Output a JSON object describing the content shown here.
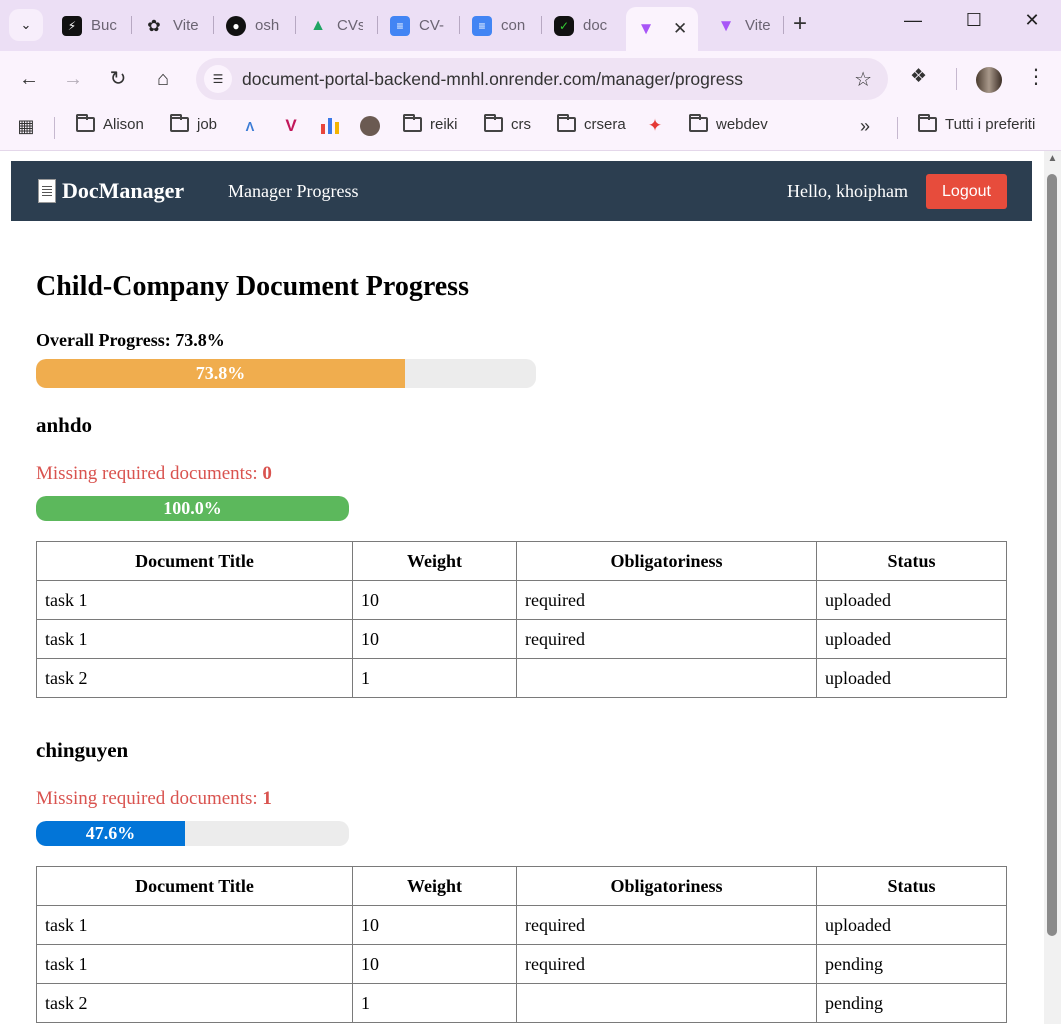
{
  "browser": {
    "tabs": [
      {
        "title": "Buc",
        "icon": "bolt-icon"
      },
      {
        "title": "Vite",
        "icon": "openai-icon"
      },
      {
        "title": "osh",
        "icon": "github-icon"
      },
      {
        "title": "CVs",
        "icon": "drive-icon"
      },
      {
        "title": "CV-",
        "icon": "docs-icon"
      },
      {
        "title": "con",
        "icon": "docs-icon"
      },
      {
        "title": "doc",
        "icon": "render-icon"
      },
      {
        "title": "",
        "icon": "vite-icon",
        "active": true
      },
      {
        "title": "Vite",
        "icon": "vite-icon"
      }
    ],
    "url": "document-portal-backend-mnhl.onrender.com/manager/progress",
    "bookmarks": [
      "Alison",
      "job",
      "reiki",
      "crs",
      "crsera",
      "webdev"
    ],
    "all_bookmarks_label": "Tutti i preferiti"
  },
  "app": {
    "brand": "DocManager",
    "nav_link": "Manager Progress",
    "greeting": "Hello, khoipham",
    "logout_label": "Logout"
  },
  "page": {
    "title": "Child-Company Document Progress",
    "overall_label": "Overall Progress: 73.8%",
    "overall_progress": 73.8,
    "overall_progress_text": "73.8%",
    "overall_color": "#f0ad4e",
    "missing_label": "Missing required documents:",
    "table_headers": [
      "Document Title",
      "Weight",
      "Obligatoriness",
      "Status"
    ]
  },
  "members": [
    {
      "name": "anhdo",
      "missing_count": "0",
      "progress": 100.0,
      "progress_text": "100.0%",
      "bar_color": "#5cb85c",
      "documents": [
        {
          "title": "task 1",
          "weight": "10",
          "obligatoriness": "required",
          "status": "uploaded"
        },
        {
          "title": "task 1",
          "weight": "10",
          "obligatoriness": "required",
          "status": "uploaded"
        },
        {
          "title": "task 2",
          "weight": "1",
          "obligatoriness": "",
          "status": "uploaded"
        }
      ]
    },
    {
      "name": "chinguyen",
      "missing_count": "1",
      "progress": 47.6,
      "progress_text": "47.6%",
      "bar_color": "#0275d8",
      "documents": [
        {
          "title": "task 1",
          "weight": "10",
          "obligatoriness": "required",
          "status": "uploaded"
        },
        {
          "title": "task 1",
          "weight": "10",
          "obligatoriness": "required",
          "status": "pending"
        },
        {
          "title": "task 2",
          "weight": "1",
          "obligatoriness": "",
          "status": "pending"
        }
      ]
    }
  ]
}
